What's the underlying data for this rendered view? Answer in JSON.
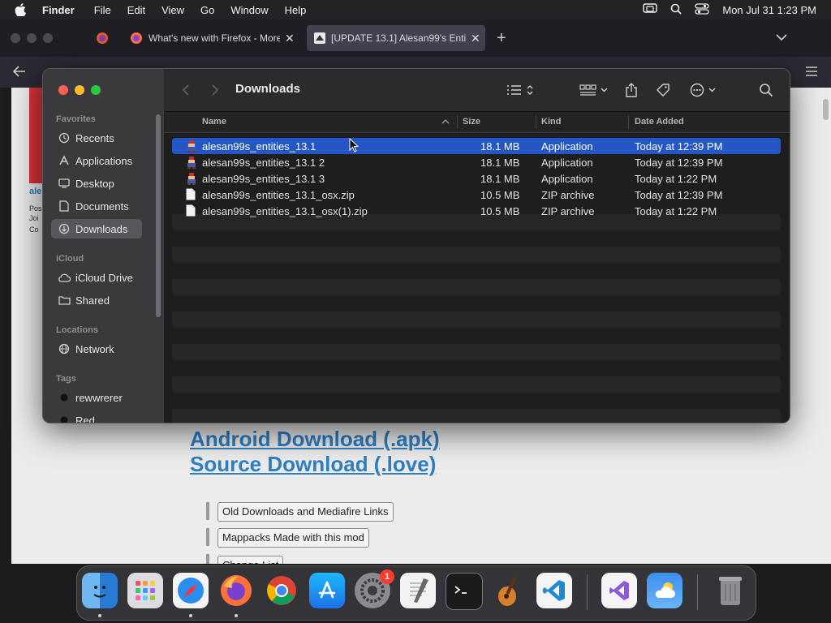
{
  "menubar": {
    "app": "Finder",
    "items": [
      "File",
      "Edit",
      "View",
      "Go",
      "Window",
      "Help"
    ],
    "clock": "Mon Jul 31  1:23 PM"
  },
  "firefox": {
    "tabs": [
      {
        "title": "What's new with Firefox - More"
      },
      {
        "title": "[UPDATE 13.1] Alesan99's Entit"
      }
    ],
    "page": {
      "links": [
        "Android Download (.apk)",
        "Source Download (.love)"
      ],
      "buttons": [
        "Old Downloads and Mediafire Links",
        "Mappacks Made with this mod",
        "Change List"
      ],
      "side_snippet": [
        "ale",
        "Pos",
        "Joi",
        "Co"
      ]
    }
  },
  "finder": {
    "title": "Downloads",
    "sidebar": {
      "favorites_label": "Favorites",
      "favorites": [
        "Recents",
        "Applications",
        "Desktop",
        "Documents",
        "Downloads"
      ],
      "icloud_label": "iCloud",
      "icloud": [
        "iCloud Drive",
        "Shared"
      ],
      "locations_label": "Locations",
      "locations": [
        "Network"
      ],
      "tags_label": "Tags",
      "tags": [
        "rewwrerer",
        "Red"
      ]
    },
    "columns": {
      "name": "Name",
      "size": "Size",
      "kind": "Kind",
      "date": "Date Added"
    },
    "files": [
      {
        "name": "alesan99s_entities_13.1",
        "size": "18.1 MB",
        "kind": "Application",
        "date": "Today at 12:39 PM",
        "icon": "app-icon",
        "selected": true
      },
      {
        "name": "alesan99s_entities_13.1 2",
        "size": "18.1 MB",
        "kind": "Application",
        "date": "Today at 12:39 PM",
        "icon": "app-icon",
        "selected": false
      },
      {
        "name": "alesan99s_entities_13.1 3",
        "size": "18.1 MB",
        "kind": "Application",
        "date": "Today at 1:22 PM",
        "icon": "app-icon",
        "selected": false
      },
      {
        "name": "alesan99s_entities_13.1_osx.zip",
        "size": "10.5 MB",
        "kind": "ZIP archive",
        "date": "Today at 12:39 PM",
        "icon": "zip-icon",
        "selected": false
      },
      {
        "name": "alesan99s_entities_13.1_osx(1).zip",
        "size": "10.5 MB",
        "kind": "ZIP archive",
        "date": "Today at 1:22 PM",
        "icon": "zip-icon",
        "selected": false
      }
    ]
  },
  "dock": {
    "apps": [
      "finder-icon",
      "launchpad-icon",
      "safari-icon",
      "firefox-icon",
      "chrome-icon",
      "app-store-icon",
      "system-settings-icon",
      "textedit-icon",
      "terminal-icon",
      "garageband-icon",
      "vscode-icon",
      "visual-studio-icon",
      "weather-icon",
      "trash-icon"
    ],
    "settings_badge": "1"
  },
  "colors": {
    "selection": "#2457c5",
    "link": "#2f7fc1",
    "sidebar": "#3a3a3c"
  }
}
